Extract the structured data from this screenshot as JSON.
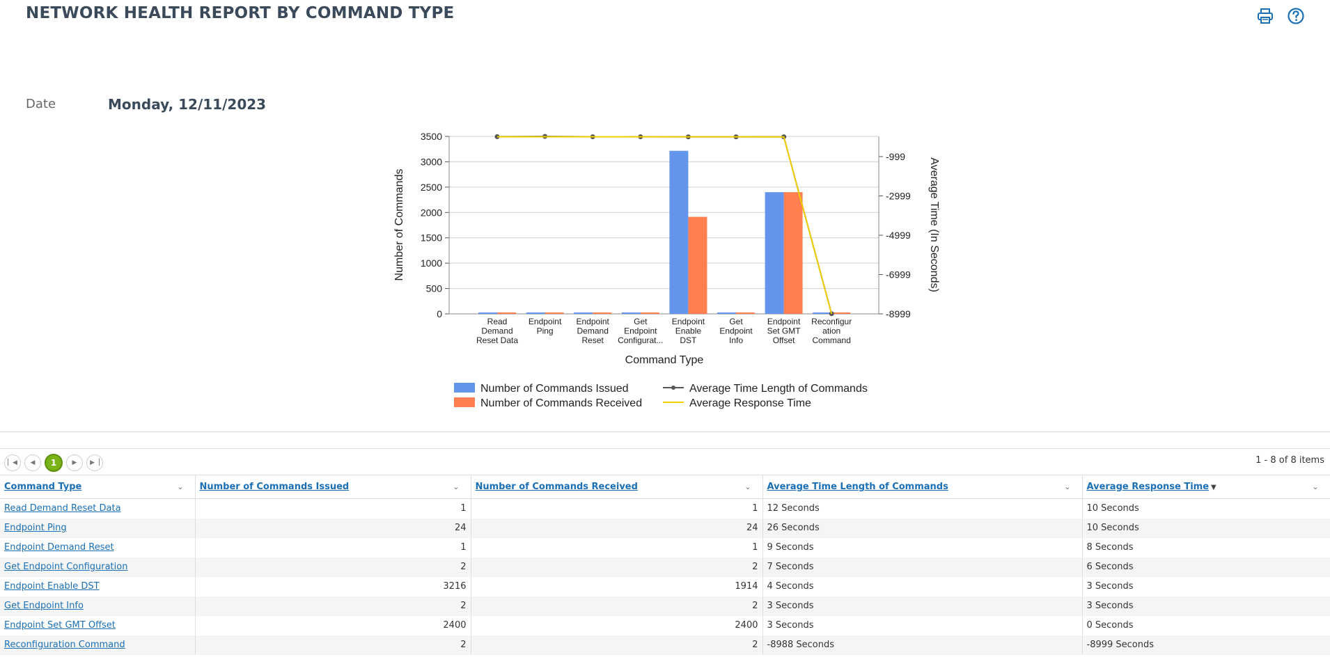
{
  "header": {
    "title": "NETWORK HEALTH REPORT BY COMMAND TYPE",
    "print_icon": "printer-icon",
    "help_icon": "help-circle-icon"
  },
  "filter": {
    "date_label": "Date",
    "date_value": "Monday, 12/11/2023"
  },
  "chart_data": {
    "type": "bar",
    "categories": [
      [
        "Read",
        "Demand",
        "Reset Data"
      ],
      [
        "Endpoint",
        "Ping"
      ],
      [
        "Endpoint",
        "Demand",
        "Reset"
      ],
      [
        "Get",
        "Endpoint",
        "Configurat..."
      ],
      [
        "Endpoint",
        "Enable",
        "DST"
      ],
      [
        "Get",
        "Endpoint",
        "Info"
      ],
      [
        "Endpoint",
        "Set GMT",
        "Offset"
      ],
      [
        "Reconfigur",
        "ation",
        "Command"
      ]
    ],
    "series": [
      {
        "name": "Number of Commands Issued",
        "kind": "bar",
        "axis": "left",
        "color": "#6495ed",
        "values": [
          1,
          24,
          1,
          2,
          3216,
          2,
          2400,
          2
        ]
      },
      {
        "name": "Number of Commands Received",
        "kind": "bar",
        "axis": "left",
        "color": "#ff7f50",
        "values": [
          1,
          24,
          1,
          2,
          1914,
          2,
          2400,
          2
        ]
      },
      {
        "name": "Average Time Length of Commands",
        "kind": "line",
        "axis": "right",
        "color": "#555555",
        "marker": true,
        "values": [
          12,
          26,
          9,
          7,
          4,
          3,
          3,
          -8988
        ]
      },
      {
        "name": "Average Response Time",
        "kind": "line",
        "axis": "right",
        "color": "#f0d000",
        "marker": false,
        "values": [
          10,
          10,
          8,
          6,
          3,
          3,
          0,
          -8999
        ]
      }
    ],
    "xlabel": "Command Type",
    "ylabel": "Number of Commands",
    "y2label": "Average Time (In Seconds)",
    "ylim": [
      0,
      3500
    ],
    "yticks": [
      "0",
      "500",
      "1000",
      "1500",
      "2000",
      "2500",
      "3000",
      "3500"
    ],
    "y2lim": [
      -8999,
      26
    ],
    "y2ticks": [
      "-8999",
      "-6999",
      "-4999",
      "-2999",
      "-999"
    ],
    "grid": true,
    "legend_position": "bottom"
  },
  "pager": {
    "first": "first-page-icon",
    "prev": "prev-page-icon",
    "current": "1",
    "next": "next-page-icon",
    "last": "last-page-icon",
    "items_text": "1 - 8 of 8 items"
  },
  "table": {
    "columns": [
      "Command Type",
      "Number of Commands Issued",
      "Number of Commands Received",
      "Average Time Length of Commands",
      "Average Response Time"
    ],
    "sort_indicator": "▼",
    "rows": [
      [
        "Read Demand Reset Data",
        "1",
        "1",
        "12 Seconds",
        "10 Seconds"
      ],
      [
        "Endpoint Ping",
        "24",
        "24",
        "26 Seconds",
        "10 Seconds"
      ],
      [
        "Endpoint Demand Reset",
        "1",
        "1",
        "9 Seconds",
        "8 Seconds"
      ],
      [
        "Get Endpoint Configuration",
        "2",
        "2",
        "7 Seconds",
        "6 Seconds"
      ],
      [
        "Endpoint Enable DST",
        "3216",
        "1914",
        "4 Seconds",
        "3 Seconds"
      ],
      [
        "Get Endpoint Info",
        "2",
        "2",
        "3 Seconds",
        "3 Seconds"
      ],
      [
        "Endpoint Set GMT Offset",
        "2400",
        "2400",
        "3 Seconds",
        "0 Seconds"
      ],
      [
        "Reconfiguration Command",
        "2",
        "2",
        "-8988 Seconds",
        "-8999 Seconds"
      ]
    ]
  }
}
